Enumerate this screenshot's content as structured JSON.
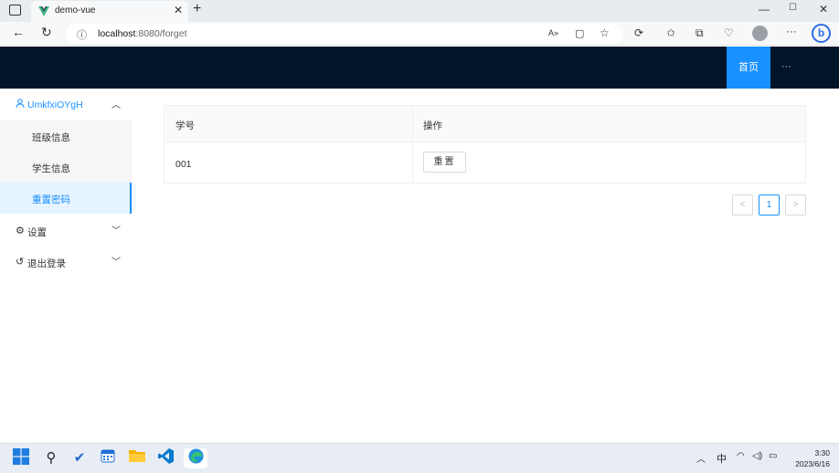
{
  "browser": {
    "tab_title": "demo-vue",
    "url_host": "localhost",
    "url_rest": ":8080/forget",
    "icons": [
      "tab-actions-icon",
      "back-icon",
      "reload-icon",
      "info-icon",
      "read-aloud-icon",
      "reader-icon",
      "favorite-icon",
      "extensions-icon",
      "favorites-icon",
      "collections-icon",
      "health-icon",
      "profile-icon",
      "more-icon",
      "bing-icon"
    ]
  },
  "header": {
    "home_label": "首页",
    "more_label": "···",
    "background": "#001529",
    "accent": "#1890ff"
  },
  "sidebar": {
    "user_menu": "UmkfxiOYgH",
    "items": [
      {
        "label": "班级信息"
      },
      {
        "label": "学生信息"
      },
      {
        "label": "重置密码"
      }
    ],
    "settings": "设置",
    "logout": "退出登录"
  },
  "table": {
    "columns": [
      "学号",
      "操作"
    ],
    "rows": [
      {
        "id": "001",
        "action": "重置"
      }
    ]
  },
  "pagination": {
    "prev": "<",
    "current": "1",
    "next": ">"
  },
  "taskbar": {
    "apps": [
      "start-icon",
      "search-icon",
      "todo-icon",
      "calendar-icon",
      "file-explorer-icon",
      "vscode-icon",
      "edge-icon"
    ],
    "ime": "中",
    "time": "3:30",
    "date": "2023/6/16"
  }
}
